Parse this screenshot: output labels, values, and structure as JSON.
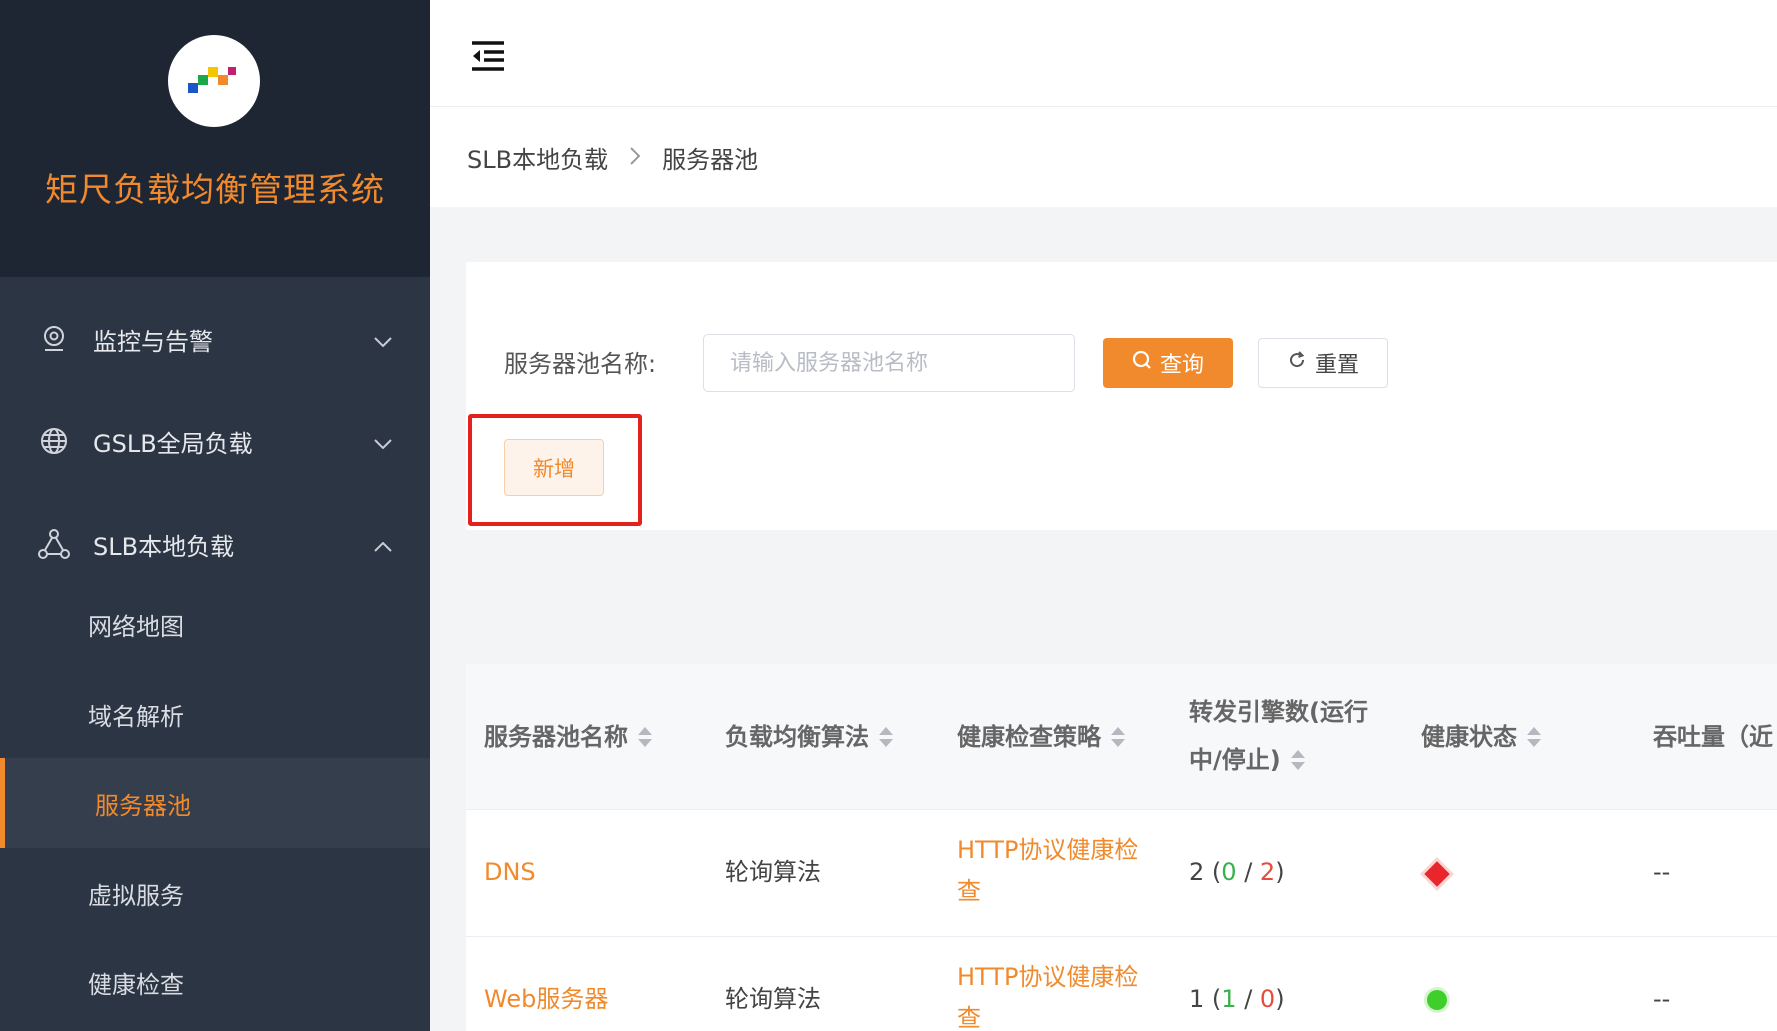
{
  "sidebar": {
    "brand_title": "矩尺负载均衡管理系统",
    "menu": [
      {
        "label": "监控与告警",
        "icon": "location-pin-icon"
      },
      {
        "label": "GSLB全局负载",
        "icon": "globe-icon"
      },
      {
        "label": "SLB本地负载",
        "icon": "network-nodes-icon"
      }
    ],
    "submenu": [
      {
        "label": "网络地图"
      },
      {
        "label": "域名解析"
      },
      {
        "label": "服务器池",
        "active": true
      },
      {
        "label": "虚拟服务"
      },
      {
        "label": "健康检查"
      }
    ]
  },
  "breadcrumb": {
    "parent": "SLB本地负载",
    "current": "服务器池"
  },
  "search": {
    "label": "服务器池名称:",
    "placeholder": "请输入服务器池名称",
    "value": "",
    "query_label": "查询",
    "reset_label": "重置",
    "add_label": "新增"
  },
  "table": {
    "headers": [
      "服务器池名称",
      "负载均衡算法",
      "健康检查策略",
      "转发引擎数(运行",
      "中/停止)",
      "健康状态",
      "吞吐量（近"
    ],
    "rows": [
      {
        "name": "DNS",
        "algo": "轮询算法",
        "policy_line1": "HTTP协议健康检",
        "policy_line2": "查",
        "total": "2",
        "running": "0",
        "stopped": "2",
        "health": "unhealthy",
        "throughput": "--"
      },
      {
        "name": "Web服务器",
        "algo": "轮询算法",
        "policy_line1": "HTTP协议健康检",
        "policy_line2": "查",
        "total": "1",
        "running": "1",
        "stopped": "0",
        "health": "healthy",
        "throughput": "--"
      }
    ]
  },
  "colors": {
    "accent": "#f08a2c",
    "sidebar_bg": "#2b3544",
    "highlight": "#e5211d"
  }
}
